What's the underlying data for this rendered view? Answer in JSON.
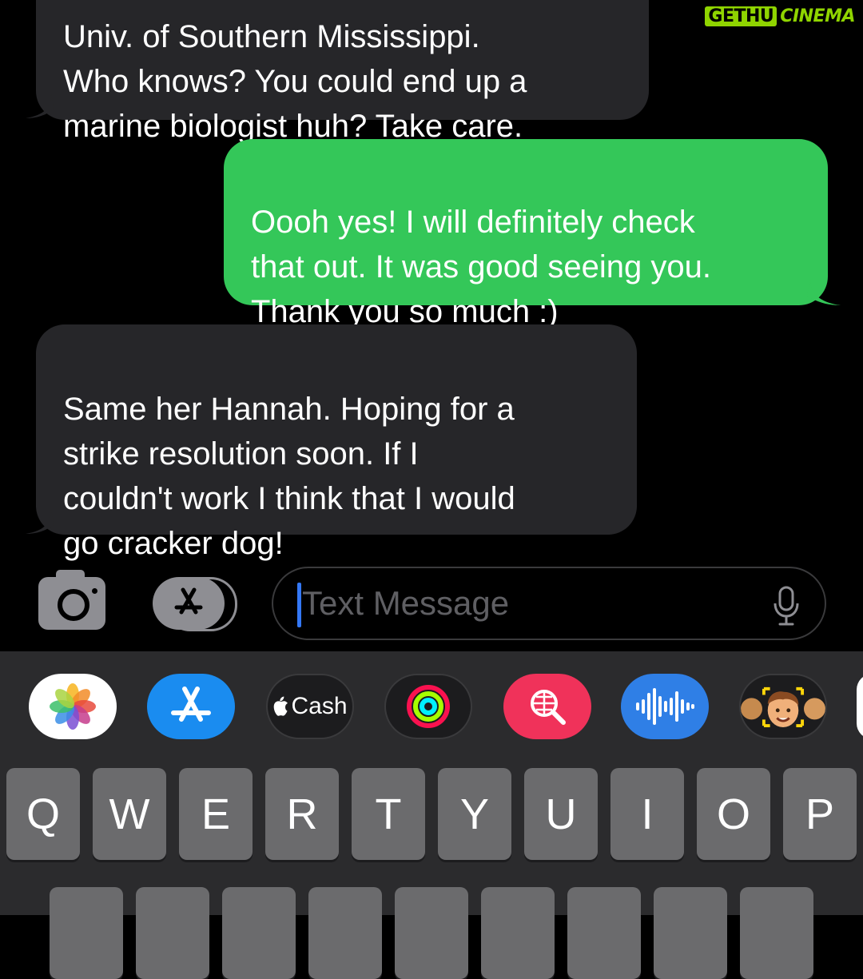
{
  "watermark": {
    "part1": "GETHU",
    "part2": "CINEMA"
  },
  "messages": [
    {
      "direction": "incoming",
      "text": "Univ. of Southern Mississippi.\nWho knows? You could end up a\nmarine biologist huh? Take care."
    },
    {
      "direction": "outgoing",
      "text": "Oooh yes! I will definitely check\nthat out. It was good seeing you.\nThank you so much :)"
    },
    {
      "direction": "incoming",
      "text": "Same her Hannah. Hoping for a\nstrike resolution soon. If I\ncouldn't work I think that I would\ngo cracker dog!"
    }
  ],
  "composer": {
    "placeholder": "Text Message",
    "icons": [
      "camera-icon",
      "app-store-icon",
      "microphone-icon"
    ]
  },
  "app_tray": [
    {
      "name": "Photos",
      "icon": "photos-icon"
    },
    {
      "name": "App Store",
      "icon": "app-store-icon"
    },
    {
      "name": "Cash",
      "label": "Cash",
      "icon": "apple-logo-icon"
    },
    {
      "name": "Fitness",
      "icon": "activity-rings-icon"
    },
    {
      "name": "Images",
      "icon": "globe-search-icon"
    },
    {
      "name": "Music",
      "icon": "audio-waveform-icon"
    },
    {
      "name": "Memoji",
      "icon": "memoji-icon"
    }
  ],
  "keyboard": {
    "row1": [
      "Q",
      "W",
      "E",
      "R",
      "T",
      "Y",
      "U",
      "I",
      "O",
      "P"
    ]
  },
  "colors": {
    "incoming_bubble": "#262629",
    "outgoing_bubble": "#34c759",
    "keyboard_bg": "#2b2b2d",
    "key": "#6b6b6d",
    "caret": "#3478f6"
  }
}
